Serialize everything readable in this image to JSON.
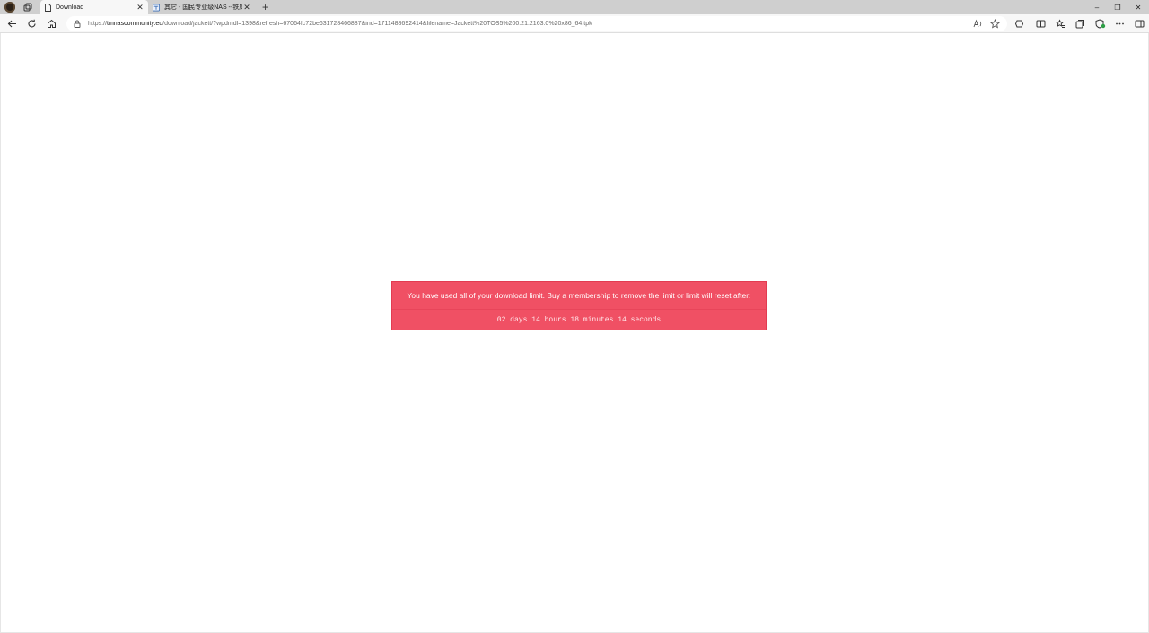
{
  "browser": {
    "tabs": [
      {
        "title": "Download",
        "active": true,
        "icon": "page-icon"
      },
      {
        "title": "其它 - 国民专业级NAS --铁威马官",
        "active": false,
        "icon": "site-favicon-icon"
      }
    ],
    "window_controls": {
      "minimize": "–",
      "restore": "❐",
      "close": "✕"
    },
    "address": {
      "scheme": "https://",
      "host": "tmnascommunity.eu",
      "path": "/download/jackett/?wpdmdl=1398&refresh=67064fc72be631728466887&ind=1711488692414&filename=Jackett%20TOS5%200.21.2163.0%20x86_64.tpk"
    }
  },
  "page": {
    "alert": {
      "message": "You have used all of your download limit. Buy a membership to remove the limit or limit will reset after:",
      "countdown": "02 days 14 hours 18 minutes 14 seconds"
    }
  },
  "colors": {
    "alert_background": "#f05064",
    "tabstrip_background": "#cfcfcf",
    "toolbar_background": "#f7f7f7"
  }
}
